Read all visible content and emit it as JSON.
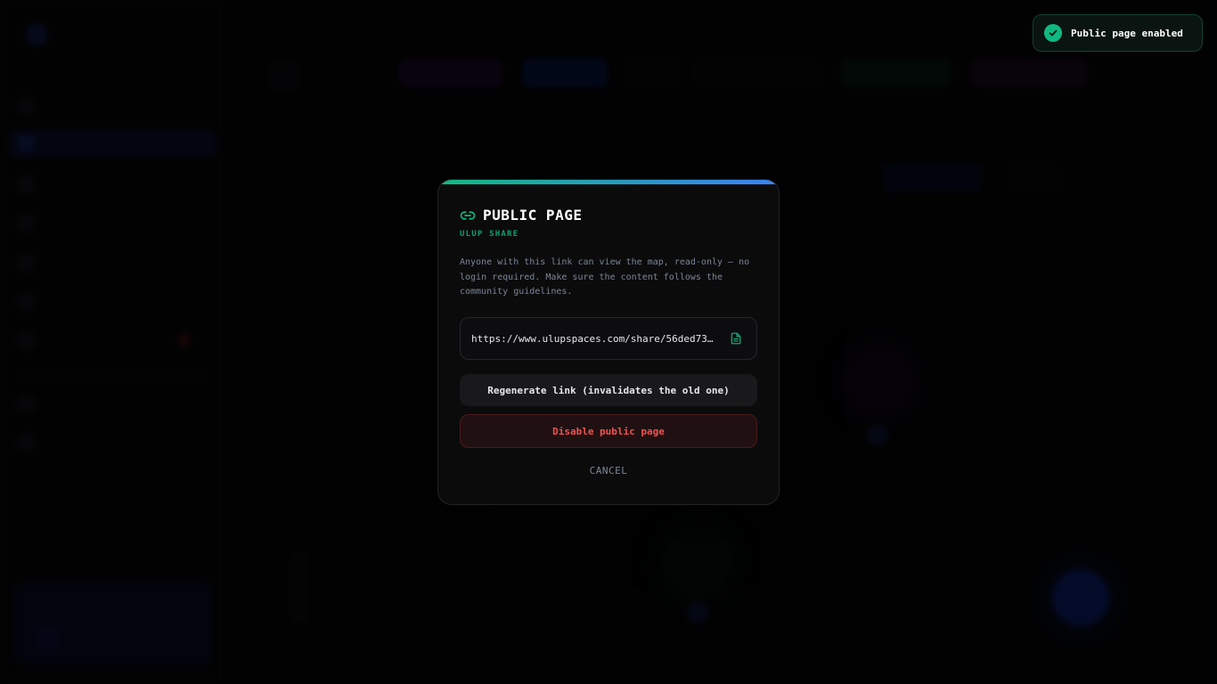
{
  "toast": {
    "message": "Public page enabled",
    "icon": "check-circle-icon",
    "color": "#10b981"
  },
  "modal": {
    "title": "PUBLIC PAGE",
    "subtitle": "ULUP SHARE",
    "description": "Anyone with this link can view the map, read-only — no login required. Make sure the content follows the community guidelines.",
    "share_url": "https://www.ulupspaces.com/share/56ded73…",
    "icons": {
      "title": "link-icon",
      "copy": "copy-icon"
    },
    "regenerate_label": "Regenerate link (invalidates the old one)",
    "disable_label": "Disable public page",
    "cancel_label": "CANCEL",
    "colors": {
      "accent_green": "#10b981",
      "accent_blue": "#3b82f6",
      "danger": "#f05252"
    }
  }
}
